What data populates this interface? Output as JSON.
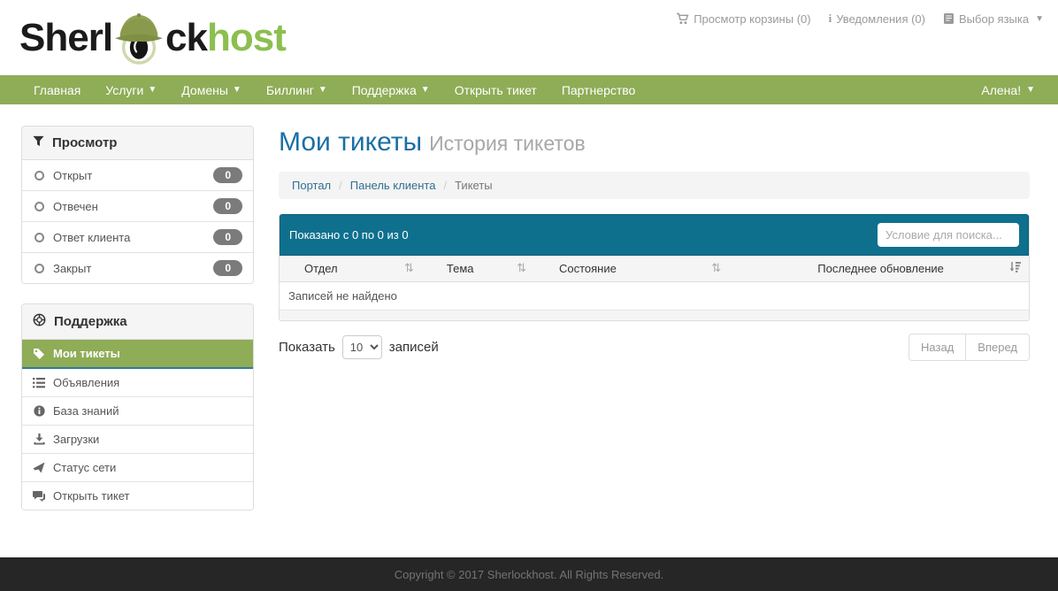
{
  "topbar": {
    "cart_label": "Просмотр корзины (0)",
    "notifications_label": "Уведомления (0)",
    "language_label": "Выбор языка",
    "info_glyph": "i"
  },
  "logo": {
    "part1": "Sherl",
    "part2": "ck",
    "part3": "host"
  },
  "navbar": {
    "items": [
      {
        "label": "Главная"
      },
      {
        "label": "Услуги"
      },
      {
        "label": "Домены"
      },
      {
        "label": "Биллинг"
      },
      {
        "label": "Поддержка"
      },
      {
        "label": "Открыть тикет"
      },
      {
        "label": "Партнерство"
      }
    ],
    "user_label": "Алена!"
  },
  "sidebar": {
    "view_panel": {
      "title": "Просмотр",
      "items": [
        {
          "label": "Открыт",
          "count": "0"
        },
        {
          "label": "Отвечен",
          "count": "0"
        },
        {
          "label": "Ответ клиента",
          "count": "0"
        },
        {
          "label": "Закрыт",
          "count": "0"
        }
      ]
    },
    "support_panel": {
      "title": "Поддержка",
      "items": [
        {
          "label": "Мои тикеты"
        },
        {
          "label": "Объявления"
        },
        {
          "label": "База знаний"
        },
        {
          "label": "Загрузки"
        },
        {
          "label": "Статус сети"
        },
        {
          "label": "Открыть тикет"
        }
      ]
    }
  },
  "main": {
    "title": "Мои тикеты",
    "subtitle": "История тикетов",
    "breadcrumb": {
      "items": [
        "Портал",
        "Панель клиента",
        "Тикеты"
      ],
      "separator": "/"
    },
    "table": {
      "summary": "Показано с 0 по 0 из 0",
      "search_placeholder": "Условие для поиска...",
      "columns": [
        "Отдел",
        "Тема",
        "Состояние",
        "Последнее обновление"
      ],
      "sort_glyph": "⇅",
      "empty_text": "Записей не найдено"
    },
    "pagination": {
      "show_label": "Показать",
      "page_size": "10",
      "records_label": "записей",
      "prev_label": "Назад",
      "next_label": "Вперед"
    }
  },
  "footer": {
    "copyright": "Copyright © 2017 Sherlockhost. All Rights Reserved."
  },
  "colors": {
    "nav_green": "#8fac57",
    "logo_green": "#8cbf4f",
    "teal": "#0f708e",
    "title_blue": "#1a6fa5",
    "badge_gray": "#7b7b7b",
    "footer_bg": "#262626"
  }
}
